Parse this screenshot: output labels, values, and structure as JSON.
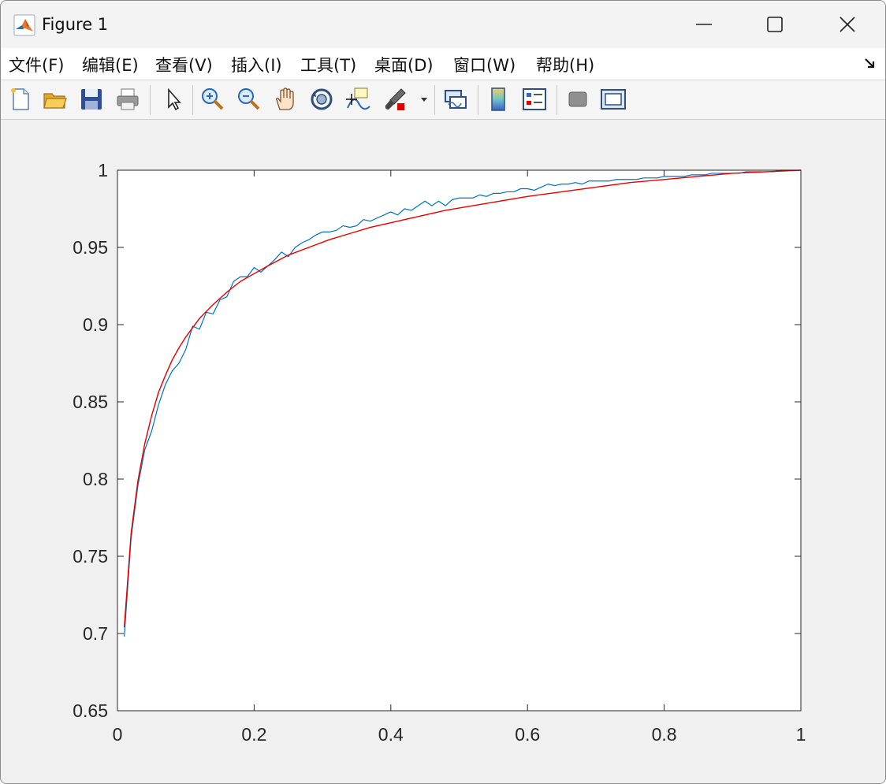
{
  "window": {
    "title": "Figure 1",
    "minimize_label": "",
    "maximize_label": "",
    "close_label": ""
  },
  "menu": [
    "文件(F)",
    "编辑(E)",
    "查看(V)",
    "插入(I)",
    "工具(T)",
    "桌面(D)",
    "窗口(W)",
    "帮助(H)"
  ],
  "toolbar": {
    "icons": [
      "new-figure-icon",
      "open-file-icon",
      "save-icon",
      "print-icon",
      "select-arrow-icon",
      "zoom-in-icon",
      "zoom-out-icon",
      "pan-hand-icon",
      "rotate-3d-icon",
      "data-cursor-icon",
      "brush-icon",
      "link-plot-icon",
      "colorbar-icon",
      "legend-icon",
      "hide-plot-tools-icon",
      "show-plot-tools-icon"
    ]
  },
  "colors": {
    "data_line": "#0072BD",
    "fit_line": "#E60000",
    "axes_background": "#ffffff",
    "figure_background": "#f0f0f0"
  },
  "chart_data": {
    "type": "line",
    "title": "",
    "xlabel": "",
    "ylabel": "",
    "xlim": [
      0,
      1
    ],
    "ylim": [
      0.65,
      1
    ],
    "grid": false,
    "box": true,
    "x_ticks": [
      "0",
      "0.2",
      "0.4",
      "0.6",
      "0.8",
      "1"
    ],
    "y_ticks": [
      "0.65",
      "0.7",
      "0.75",
      "0.8",
      "0.85",
      "0.9",
      "0.95",
      "1"
    ],
    "series": [
      {
        "color": "#0072BD",
        "x": [
          0.01,
          0.02,
          0.03,
          0.04,
          0.05,
          0.06,
          0.07,
          0.08,
          0.09,
          0.1,
          0.11,
          0.12,
          0.13,
          0.14,
          0.15,
          0.16,
          0.17,
          0.18,
          0.19,
          0.2,
          0.21,
          0.22,
          0.23,
          0.24,
          0.25,
          0.26,
          0.27,
          0.28,
          0.29,
          0.3,
          0.31,
          0.32,
          0.33,
          0.34,
          0.35,
          0.36,
          0.37,
          0.38,
          0.39,
          0.4,
          0.41,
          0.42,
          0.43,
          0.44,
          0.45,
          0.46,
          0.47,
          0.48,
          0.49,
          0.5,
          0.51,
          0.52,
          0.53,
          0.54,
          0.55,
          0.56,
          0.57,
          0.58,
          0.59,
          0.6,
          0.61,
          0.62,
          0.63,
          0.64,
          0.65,
          0.66,
          0.67,
          0.68,
          0.69,
          0.7,
          0.71,
          0.72,
          0.73,
          0.74,
          0.75,
          0.76,
          0.77,
          0.78,
          0.79,
          0.8,
          0.81,
          0.82,
          0.83,
          0.84,
          0.85,
          0.86,
          0.87,
          0.88,
          0.89,
          0.9,
          0.91,
          0.92,
          0.93,
          0.94,
          0.95,
          0.96,
          0.97,
          0.98,
          0.99,
          1.0
        ],
        "y": [
          0.698,
          0.762,
          0.796,
          0.819,
          0.831,
          0.848,
          0.861,
          0.87,
          0.875,
          0.884,
          0.899,
          0.897,
          0.908,
          0.907,
          0.916,
          0.918,
          0.928,
          0.931,
          0.931,
          0.937,
          0.934,
          0.938,
          0.942,
          0.947,
          0.944,
          0.95,
          0.953,
          0.955,
          0.958,
          0.96,
          0.96,
          0.961,
          0.964,
          0.963,
          0.964,
          0.968,
          0.967,
          0.969,
          0.971,
          0.973,
          0.971,
          0.975,
          0.974,
          0.977,
          0.98,
          0.977,
          0.98,
          0.977,
          0.981,
          0.982,
          0.982,
          0.982,
          0.984,
          0.983,
          0.985,
          0.985,
          0.986,
          0.986,
          0.988,
          0.988,
          0.987,
          0.989,
          0.991,
          0.99,
          0.991,
          0.991,
          0.992,
          0.991,
          0.993,
          0.993,
          0.993,
          0.993,
          0.994,
          0.994,
          0.994,
          0.994,
          0.995,
          0.995,
          0.995,
          0.996,
          0.996,
          0.996,
          0.996,
          0.997,
          0.997,
          0.997,
          0.998,
          0.998,
          0.998,
          0.998,
          0.998,
          0.999,
          0.999,
          0.999,
          0.999,
          0.999,
          1.0,
          1.0,
          1.0,
          1.0
        ]
      },
      {
        "color": "#E60000",
        "x": [
          0.01,
          0.02,
          0.03,
          0.04,
          0.05,
          0.06,
          0.07,
          0.08,
          0.09,
          0.1,
          0.12,
          0.14,
          0.16,
          0.18,
          0.2,
          0.22,
          0.25,
          0.28,
          0.31,
          0.34,
          0.37,
          0.4,
          0.44,
          0.48,
          0.52,
          0.56,
          0.6,
          0.65,
          0.7,
          0.75,
          0.8,
          0.85,
          0.9,
          0.95,
          1.0
        ],
        "y": [
          0.704,
          0.765,
          0.799,
          0.823,
          0.841,
          0.856,
          0.867,
          0.877,
          0.885,
          0.892,
          0.904,
          0.913,
          0.921,
          0.928,
          0.933,
          0.938,
          0.945,
          0.95,
          0.955,
          0.959,
          0.963,
          0.966,
          0.97,
          0.974,
          0.977,
          0.98,
          0.983,
          0.986,
          0.989,
          0.992,
          0.994,
          0.996,
          0.998,
          0.999,
          1.0
        ]
      }
    ]
  }
}
